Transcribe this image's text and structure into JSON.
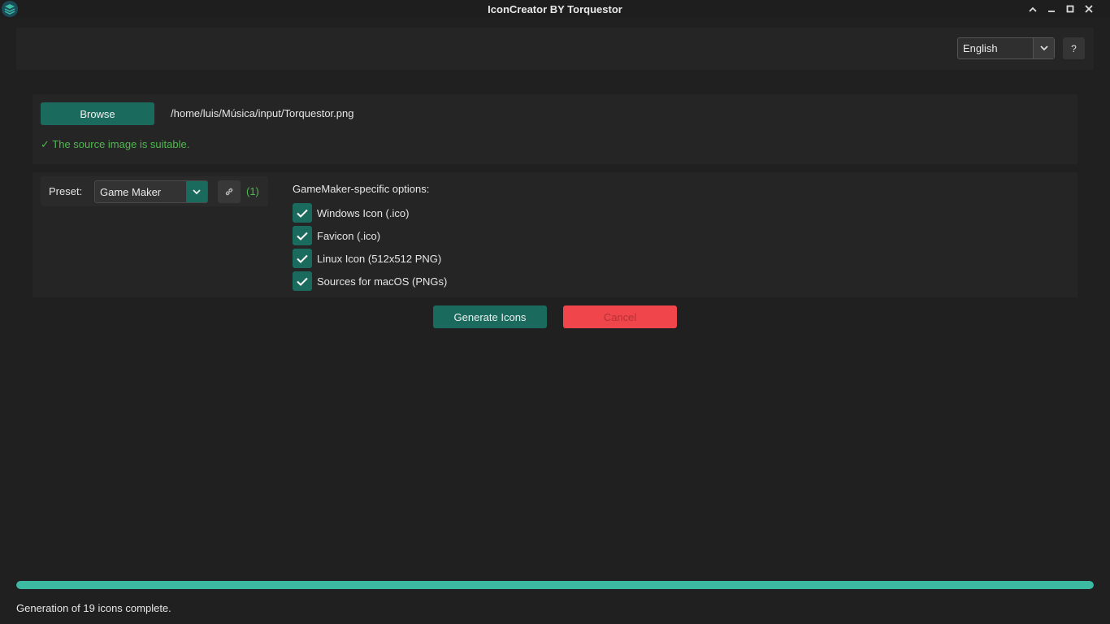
{
  "window": {
    "title": "IconCreator BY Torquestor"
  },
  "topbar": {
    "language_selected": "English",
    "help_label": "?"
  },
  "source": {
    "browse_label": "Browse",
    "file_path": "/home/luis/Música/input/Torquestor.png",
    "status_message": "✓ The source image is suitable."
  },
  "preset": {
    "label": "Preset:",
    "selected": "Game Maker",
    "link_icon": "link-icon",
    "count": "(1)"
  },
  "gamemaker_options": {
    "title": "GameMaker-specific options:",
    "items": [
      {
        "label": "Windows Icon (.ico)",
        "checked": true
      },
      {
        "label": "Favicon (.ico)",
        "checked": true
      },
      {
        "label": "Linux Icon (512x512 PNG)",
        "checked": true
      },
      {
        "label": "Sources for macOS (PNGs)",
        "checked": true
      }
    ]
  },
  "actions": {
    "generate_label": "Generate Icons",
    "cancel_label": "Cancel"
  },
  "progress": {
    "percent": 100,
    "status": "Generation of 19 icons complete."
  },
  "colors": {
    "accent": "#1a6b5d",
    "progress": "#3cb9a1",
    "success_text": "#4fb84f",
    "cancel": "#f0454a"
  }
}
